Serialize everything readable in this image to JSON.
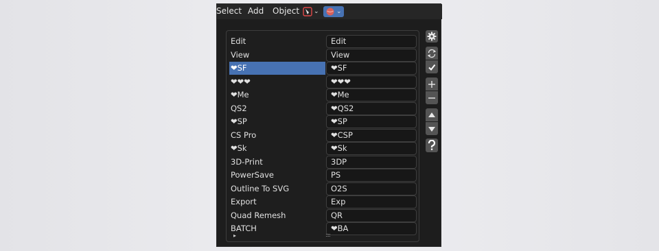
{
  "header": {
    "menus": [
      "Select",
      "Add",
      "Object"
    ],
    "icons": [
      "tool-icon",
      "sphere-icon"
    ]
  },
  "panel": {
    "rows": [
      {
        "label": "Edit",
        "value": "Edit"
      },
      {
        "label": "View",
        "value": "View"
      },
      {
        "label": "❤SF",
        "value": "❤SF",
        "selected": true
      },
      {
        "label": "❤❤❤",
        "value": "❤❤❤"
      },
      {
        "label": "❤Me",
        "value": "❤Me"
      },
      {
        "label": "QS2",
        "value": "❤QS2"
      },
      {
        "label": "❤SP",
        "value": "❤SP"
      },
      {
        "label": "CS Pro",
        "value": "❤CSP"
      },
      {
        "label": "❤Sk",
        "value": "❤Sk"
      },
      {
        "label": "3D-Print",
        "value": "3DP"
      },
      {
        "label": "PowerSave",
        "value": "PS"
      },
      {
        "label": "Outline To SVG",
        "value": "O2S"
      },
      {
        "label": "Export",
        "value": "Exp"
      },
      {
        "label": "Quad Remesh",
        "value": "QR"
      },
      {
        "label": "BATCH",
        "value": "❤BA"
      }
    ],
    "expand_glyph": "▸",
    "resize_grip": "::::"
  },
  "side_buttons": [
    "gear-icon",
    "refresh-icon",
    "check-icon",
    "plus-icon",
    "minus-icon",
    "up-arrow-icon",
    "down-arrow-icon",
    "help-icon"
  ],
  "colors": {
    "selection": "#4772b3",
    "background": "#1d1d1d",
    "header": "#262626",
    "tool_icon": "#e04848",
    "sphere_icon": "#d9605a",
    "dropdown_active": "#4772b3"
  }
}
